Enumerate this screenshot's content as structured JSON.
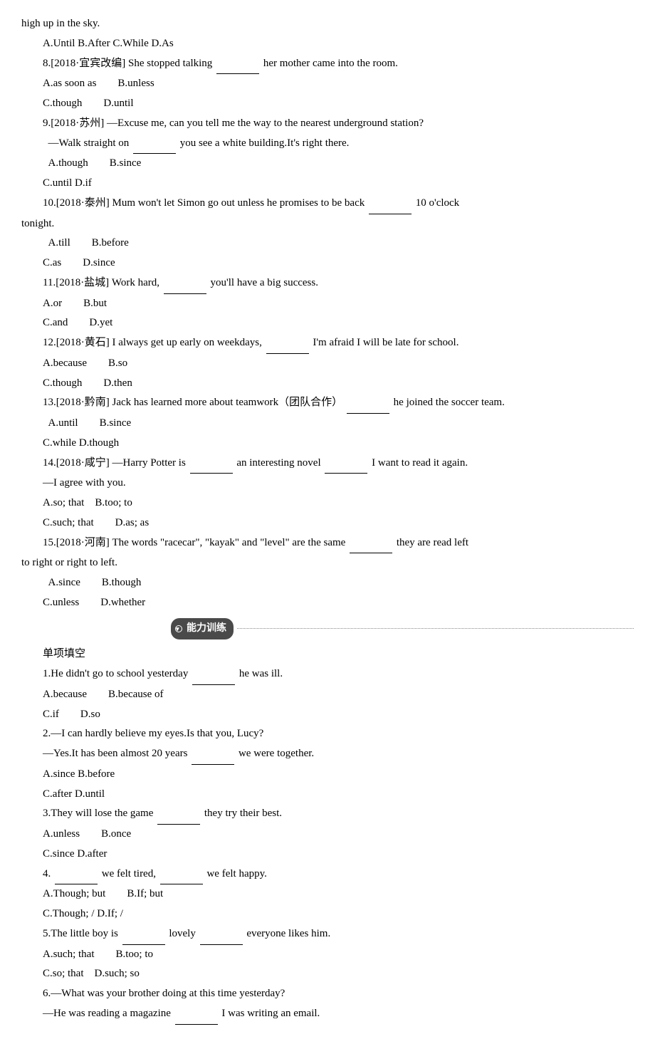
{
  "q_tail_7": "high up in the sky.",
  "opt_7": "A.Until B.After C.While D.As",
  "q8": "8.[2018·宜宾改编] She stopped talking　　　　her mother came into the room.",
  "opt_8a": "A.as soon as　　B.unless",
  "opt_8b": "C.though　　D.until",
  "q9a": "9.[2018·苏州] —Excuse me, can you tell me the way to the nearest underground station?",
  "q9b": "—Walk straight on　　　　you see a white building.It's right there.",
  "opt_9a": "A.though　　B.since",
  "opt_9b": "C.until D.if",
  "q10a": "10.[2018·泰州] Mum won't let Simon go out unless he promises to be back　　　　10 o'clock",
  "q10b": "tonight.",
  "opt_10a": "A.till　　B.before",
  "opt_10b": "C.as　　D.since",
  "q11": "11.[2018·盐城] Work hard,　　　　you'll have a big success.",
  "opt_11a": "A.or　　B.but",
  "opt_11b": "C.and　　D.yet",
  "q12": "12.[2018·黄石] I always get up early on weekdays,　　　　I'm afraid I will be late for school.",
  "opt_12a": "A.because　　B.so",
  "opt_12b": "C.though　　D.then",
  "q13": "13.[2018·黔南] Jack has learned more about teamwork（团队合作）　　　　he joined the soccer team.",
  "opt_13a": "A.until　　B.since",
  "opt_13b": "C.while D.though",
  "q14a": "14.[2018·咸宁] —Harry Potter is　　　　an interesting novel　　　　I want to read it again.",
  "q14b": "—I agree with you.",
  "opt_14a": "A.so; that　B.too; to",
  "opt_14b": "C.such; that　　D.as; as",
  "q15a": "15.[2018·河南] The words \"racecar\", \"kayak\" and \"level\" are the same　　　　they are read left",
  "q15b": "to right or right to left.",
  "opt_15a": "A.since　　B.though",
  "opt_15b": "C.unless　　D.whether",
  "section_label": "能力训练",
  "section_sub": "单项填空",
  "p1": "1.He didn't go to school yesterday　　　　he was ill.",
  "p1a": "A.because　　B.because of",
  "p1b": "C.if　　D.so",
  "p2a": "2.—I can hardly believe my eyes.Is that you, Lucy?",
  "p2b": "—Yes.It has been almost 20 years　　　　we were together.",
  "p2c": "A.since B.before",
  "p2d": "C.after D.until",
  "p3": "3.They will lose the game　　　　they try their best.",
  "p3a": "A.unless　　B.once",
  "p3b": "C.since D.after",
  "p4": "4.　　　　we felt tired,　　　　we felt happy.",
  "p4a": "A.Though; but　　B.If; but",
  "p4b": "C.Though; / D.If; /",
  "p5": "5.The little boy is 　　　　lovely　　　　everyone likes him.",
  "p5a": "A.such; that　　B.too; to",
  "p5b": "C.so; that　D.such; so",
  "p6a": "6.—What was your brother doing at this time yesterday?",
  "p6b": "—He was reading a magazine　　　　I was writing an e­mail."
}
